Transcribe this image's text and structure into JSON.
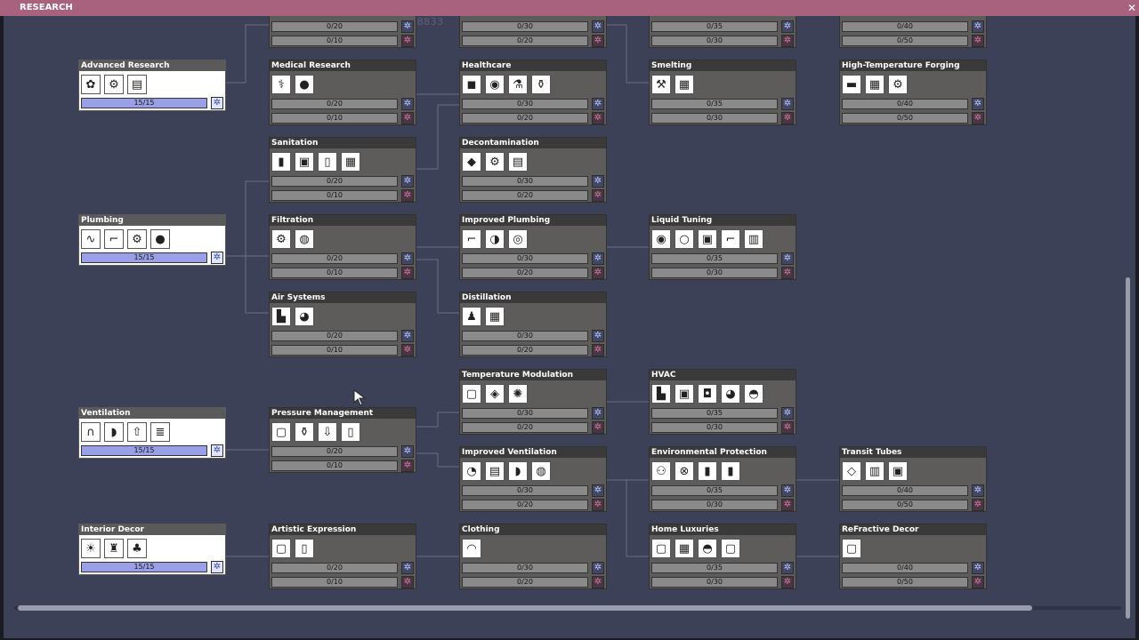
{
  "window": {
    "title": "RESEARCH",
    "close_label": "✕"
  },
  "watermark": "DEVELOPMENT BUILD: CU-28833",
  "nodes": [
    {
      "title": "",
      "icons": [],
      "bars": [
        "0/20",
        "0/10"
      ]
    },
    {
      "title": "",
      "icons": [],
      "bars": [
        "0/30",
        "0/20"
      ]
    },
    {
      "title": "",
      "icons": [],
      "bars": [
        "0/35",
        "0/30"
      ]
    },
    {
      "title": "",
      "icons": [],
      "bars": [
        "0/40",
        "0/50"
      ]
    },
    {
      "title": "Advanced Research",
      "icons": [
        "✿",
        "⚙",
        "▤"
      ],
      "bars": [
        "15/15"
      ],
      "completed": true
    },
    {
      "title": "Medical Research",
      "icons": [
        "⚕",
        "●"
      ],
      "bars": [
        "0/20",
        "0/10"
      ]
    },
    {
      "title": "Healthcare",
      "icons": [
        "◼",
        "◉",
        "⚗",
        "⚱"
      ],
      "bars": [
        "0/30",
        "0/20"
      ]
    },
    {
      "title": "Smelting",
      "icons": [
        "⚒",
        "▦"
      ],
      "bars": [
        "0/35",
        "0/30"
      ]
    },
    {
      "title": "High-Temperature Forging",
      "icons": [
        "▬",
        "▦",
        "⚙"
      ],
      "bars": [
        "0/40",
        "0/50"
      ]
    },
    {
      "title": "Sanitation",
      "icons": [
        "▮",
        "▣",
        "▯",
        "▦"
      ],
      "bars": [
        "0/20",
        "0/10"
      ]
    },
    {
      "title": "Decontamination",
      "icons": [
        "◆",
        "⚙",
        "▤"
      ],
      "bars": [
        "0/30",
        "0/20"
      ]
    },
    {
      "title": "Plumbing",
      "icons": [
        "∿",
        "⌐",
        "⚙",
        "●"
      ],
      "bars": [
        "15/15"
      ],
      "completed": true
    },
    {
      "title": "Filtration",
      "icons": [
        "⚙",
        "◍"
      ],
      "bars": [
        "0/20",
        "0/10"
      ]
    },
    {
      "title": "Improved Plumbing",
      "icons": [
        "⌐",
        "◑",
        "◎"
      ],
      "bars": [
        "0/30",
        "0/20"
      ]
    },
    {
      "title": "Liquid Tuning",
      "icons": [
        "◉",
        "○",
        "▣",
        "⌐",
        "▥"
      ],
      "bars": [
        "0/35",
        "0/30"
      ]
    },
    {
      "title": "Air Systems",
      "icons": [
        "▙",
        "◕"
      ],
      "bars": [
        "0/20",
        "0/10"
      ]
    },
    {
      "title": "Distillation",
      "icons": [
        "♟",
        "▦"
      ],
      "bars": [
        "0/30",
        "0/20"
      ]
    },
    {
      "title": "Temperature Modulation",
      "icons": [
        "▢",
        "◈",
        "✺"
      ],
      "bars": [
        "0/30",
        "0/20"
      ]
    },
    {
      "title": "HVAC",
      "icons": [
        "▙",
        "▣",
        "◘",
        "◕",
        "◓"
      ],
      "bars": [
        "0/35",
        "0/30"
      ]
    },
    {
      "title": "Ventilation",
      "icons": [
        "∩",
        "◗",
        "⇧",
        "≣"
      ],
      "bars": [
        "15/15"
      ],
      "completed": true
    },
    {
      "title": "Pressure Management",
      "icons": [
        "▢",
        "⚱",
        "⇩",
        "▯"
      ],
      "bars": [
        "0/20",
        "0/10"
      ]
    },
    {
      "title": "Improved Ventilation",
      "icons": [
        "◔",
        "▤",
        "◗",
        "◍"
      ],
      "bars": [
        "0/30",
        "0/20"
      ]
    },
    {
      "title": "Environmental Protection",
      "icons": [
        "⚇",
        "⊗",
        "▮",
        "▮"
      ],
      "bars": [
        "0/35",
        "0/30"
      ]
    },
    {
      "title": "Transit Tubes",
      "icons": [
        "◇",
        "▥",
        "▣"
      ],
      "bars": [
        "0/40",
        "0/50"
      ]
    },
    {
      "title": "Interior Decor",
      "icons": [
        "☀",
        "♜",
        "♣"
      ],
      "bars": [
        "15/15"
      ],
      "completed": true
    },
    {
      "title": "Artistic Expression",
      "icons": [
        "▢",
        "▯"
      ],
      "bars": [
        "0/20",
        "0/10"
      ]
    },
    {
      "title": "Clothing",
      "icons": [
        "◠"
      ],
      "bars": [
        "0/30",
        "0/20"
      ]
    },
    {
      "title": "Home Luxuries",
      "icons": [
        "▢",
        "▦",
        "◓",
        "▢"
      ],
      "bars": [
        "0/35",
        "0/30"
      ]
    },
    {
      "title": "ReFractive Decor",
      "icons": [
        "▢"
      ],
      "bars": [
        "0/40",
        "0/50"
      ]
    }
  ]
}
